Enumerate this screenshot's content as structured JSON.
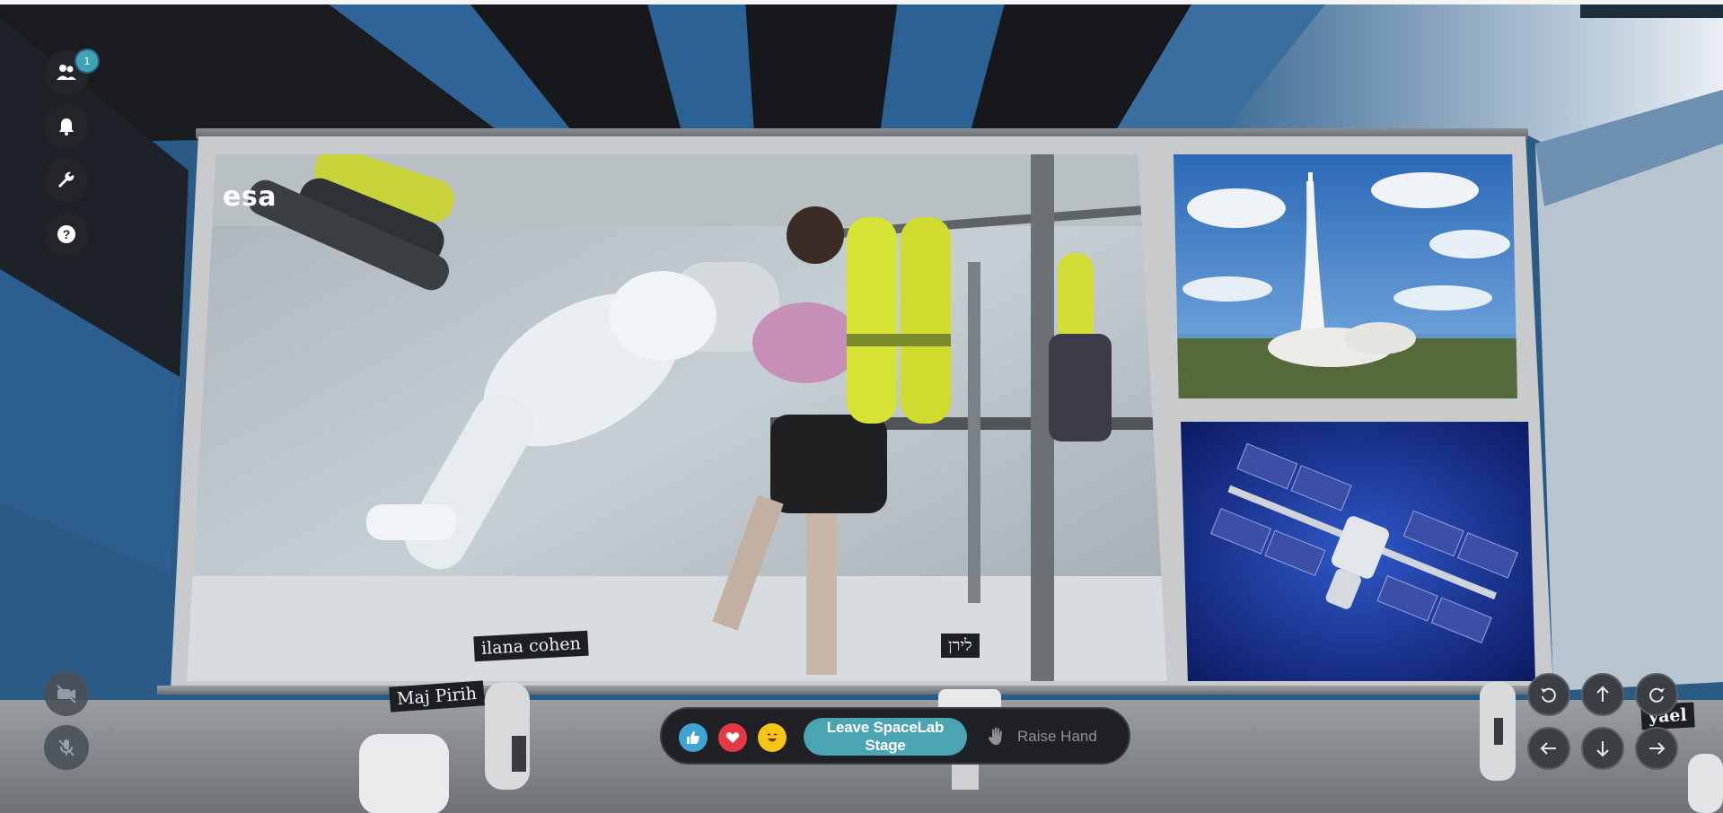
{
  "participants": {
    "count_badge": "1"
  },
  "screen": {
    "main_video_logo": "esa"
  },
  "name_tags": {
    "ilana": "ilana cohen",
    "liran": "לירן",
    "maj": "Maj Pirih",
    "yael": "yael"
  },
  "reactions": {
    "like_icon": "thumbs-up",
    "heart_icon": "heart",
    "laugh_icon": "laughing-face",
    "leave_label": "Leave SpaceLab Stage",
    "raise_label": "Raise Hand"
  },
  "colors": {
    "accent": "#4aa4b1",
    "toolbar_bg": "#232528",
    "heart": "#e53946",
    "like": "#3fa3d6",
    "laugh": "#f5c414"
  }
}
